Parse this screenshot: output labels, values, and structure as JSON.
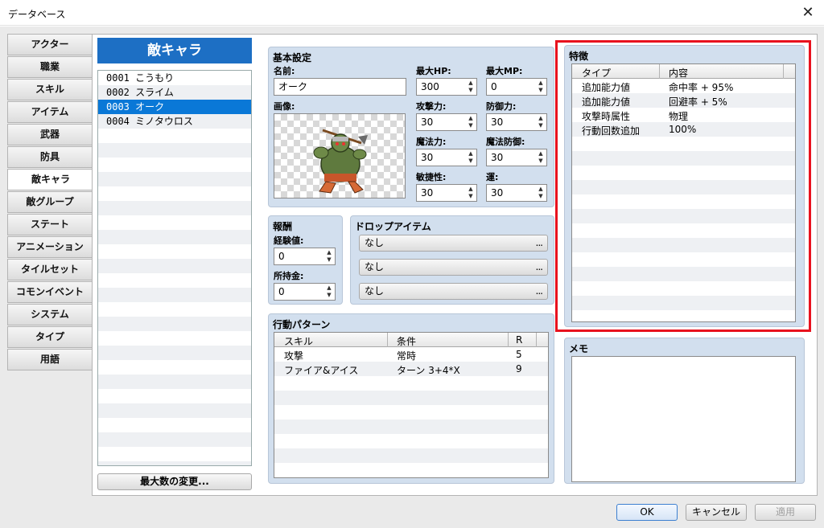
{
  "window": {
    "title": "データベース",
    "close_glyph": "✕"
  },
  "nav": {
    "items": [
      "アクター",
      "職業",
      "スキル",
      "アイテム",
      "武器",
      "防具",
      "敵キャラ",
      "敵グループ",
      "ステート",
      "アニメーション",
      "タイルセット",
      "コモンイベント",
      "システム",
      "タイプ",
      "用語"
    ],
    "active_index": 6
  },
  "enemy_list": {
    "header": "敵キャラ",
    "items": [
      "0001 こうもり",
      "0002 スライム",
      "0003 オーク",
      "0004 ミノタウロス"
    ],
    "selected_index": 2,
    "max_button": "最大数の変更..."
  },
  "basic": {
    "title": "基本設定",
    "name_label": "名前:",
    "name_value": "オーク",
    "image_label": "画像:",
    "maxhp_label": "最大HP:",
    "maxhp_value": "300",
    "maxmp_label": "最大MP:",
    "maxmp_value": "0",
    "atk_label": "攻撃力:",
    "atk_value": "30",
    "def_label": "防御力:",
    "def_value": "30",
    "mat_label": "魔法力:",
    "mat_value": "30",
    "mdf_label": "魔法防御:",
    "mdf_value": "30",
    "agi_label": "敏捷性:",
    "agi_value": "30",
    "luk_label": "運:",
    "luk_value": "30"
  },
  "reward": {
    "title": "報酬",
    "exp_label": "経験値:",
    "exp_value": "0",
    "gold_label": "所持金:",
    "gold_value": "0"
  },
  "drops": {
    "title": "ドロップアイテム",
    "items": [
      "なし",
      "なし",
      "なし"
    ],
    "ellipsis": "..."
  },
  "actions": {
    "title": "行動パターン",
    "headers": [
      "スキル",
      "条件",
      "R"
    ],
    "rows": [
      [
        "攻撃",
        "常時",
        "5"
      ],
      [
        "ファイア&アイス",
        "ターン 3+4*X",
        "9"
      ]
    ]
  },
  "traits": {
    "title": "特徴",
    "headers": [
      "タイプ",
      "内容"
    ],
    "rows": [
      [
        "追加能力値",
        "命中率 + 95%"
      ],
      [
        "追加能力値",
        "回避率 + 5%"
      ],
      [
        "攻撃時属性",
        "物理"
      ],
      [
        "行動回数追加",
        "100%"
      ]
    ]
  },
  "memo": {
    "title": "メモ"
  },
  "footer": {
    "ok": "OK",
    "cancel": "キャンセル",
    "apply": "適用"
  },
  "colors": {
    "accent": "#1d6fc4",
    "selection": "#0a78d7",
    "highlight_border": "#e8121e",
    "group_bg": "#d2dfee"
  }
}
